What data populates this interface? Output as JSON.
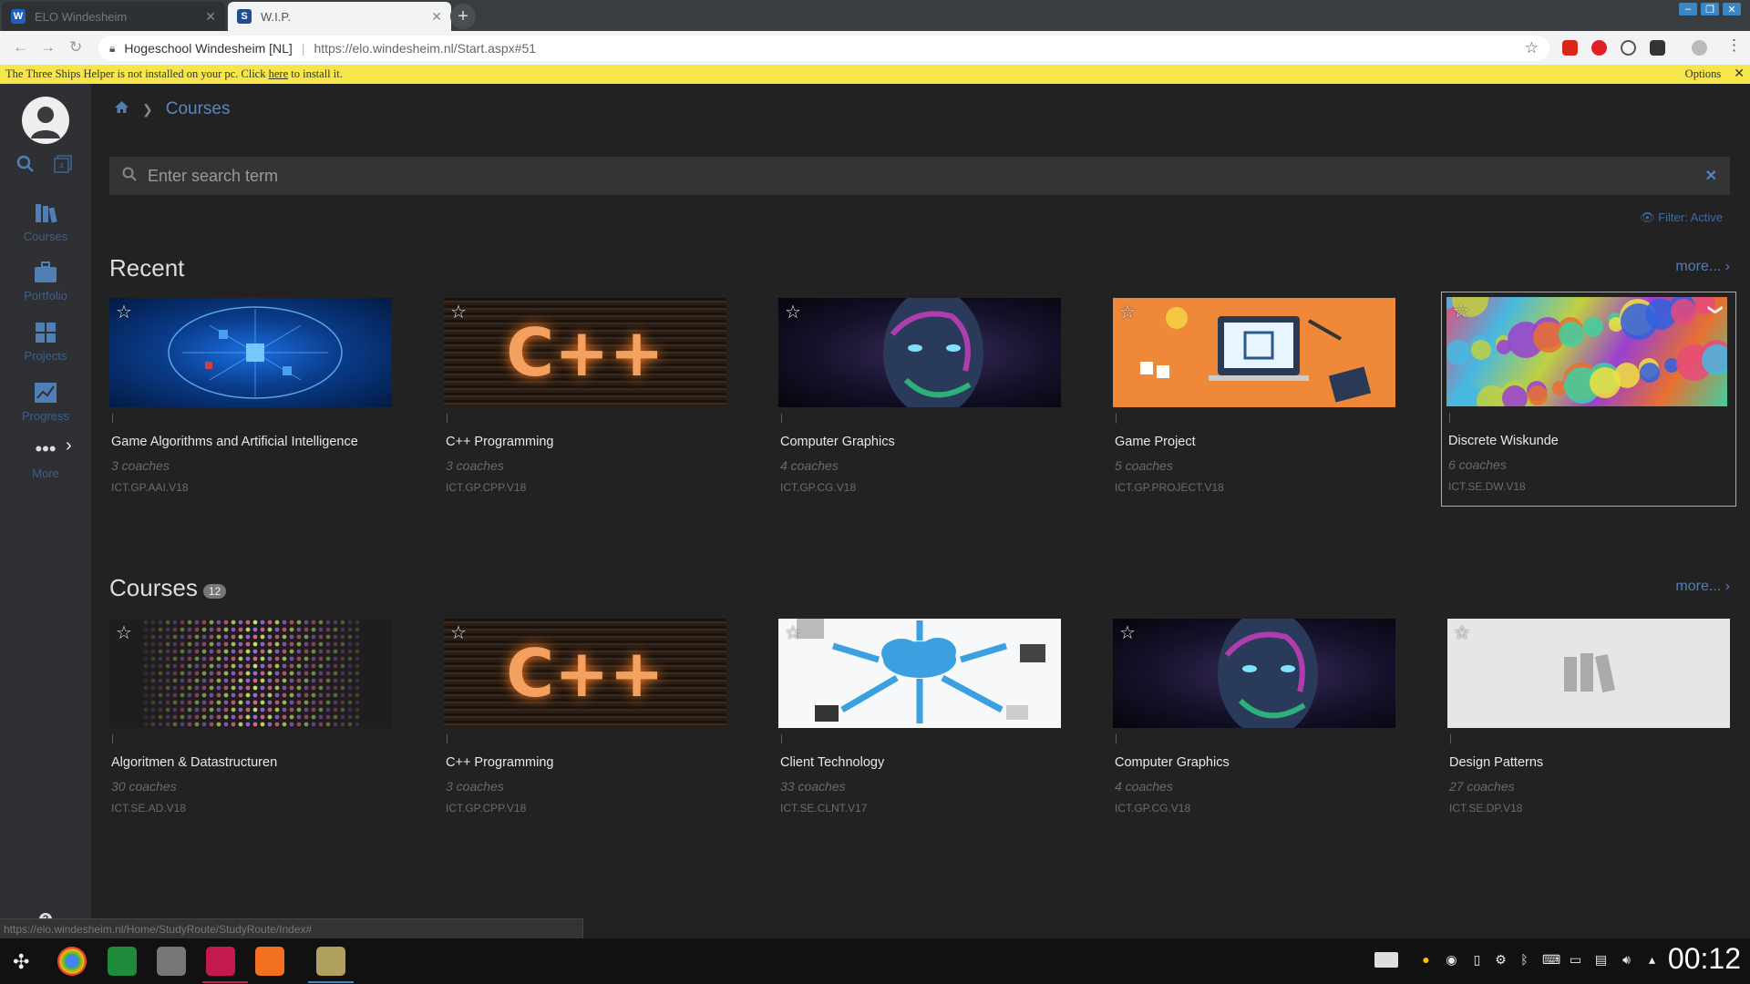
{
  "browser": {
    "tabs": [
      {
        "title": "ELO Windesheim",
        "favicon": "W",
        "active": false
      },
      {
        "title": "W.I.P.",
        "favicon": "S",
        "active": true
      }
    ],
    "address": {
      "site": "Hogeschool Windesheim [NL]",
      "url": "https://elo.windesheim.nl/Start.aspx#51"
    },
    "infobar": {
      "text": "The Three Ships Helper is not installed on your pc. Click",
      "link": "here",
      "suffix": "to install it.",
      "options": "Options"
    },
    "status_url": "https://elo.windesheim.nl/Home/StudyRoute/StudyRoute/Index#"
  },
  "sidebar": {
    "items": [
      {
        "label": "Courses",
        "icon": "books-icon"
      },
      {
        "label": "Portfolio",
        "icon": "briefcase-icon"
      },
      {
        "label": "Projects",
        "icon": "puzzle-icon"
      },
      {
        "label": "Progress",
        "icon": "chart-icon"
      },
      {
        "label": "More",
        "icon": "ellipsis-icon"
      }
    ]
  },
  "breadcrumb": {
    "current": "Courses"
  },
  "search": {
    "placeholder": "Enter search term"
  },
  "filter": {
    "label": "Filter: Active"
  },
  "recent": {
    "title": "Recent",
    "more": "more...",
    "cards": [
      {
        "name": "Game Algorithms and Artificial Intelligence",
        "coaches": "3 coaches",
        "code": "ICT.GP.AAI.V18",
        "thumb": "ai"
      },
      {
        "name": "C++ Programming",
        "coaches": "3 coaches",
        "code": "ICT.GP.CPP.V18",
        "thumb": "cpp"
      },
      {
        "name": "Computer Graphics",
        "coaches": "4 coaches",
        "code": "ICT.GP.CG.V18",
        "thumb": "cg"
      },
      {
        "name": "Game Project",
        "coaches": "5 coaches",
        "code": "ICT.GP.PROJECT.V18",
        "thumb": "gp"
      },
      {
        "name": "Discrete Wiskunde",
        "coaches": "6 coaches",
        "code": "ICT.SE.DW.V18",
        "thumb": "dw"
      }
    ]
  },
  "courses": {
    "title": "Courses",
    "count": "12",
    "more": "more...",
    "cards": [
      {
        "name": "Algoritmen & Datastructuren",
        "coaches": "30 coaches",
        "code": "ICT.SE.AD.V18",
        "thumb": "algo"
      },
      {
        "name": "C++ Programming",
        "coaches": "3 coaches",
        "code": "ICT.GP.CPP.V18",
        "thumb": "cpp"
      },
      {
        "name": "Client Technology",
        "coaches": "33 coaches",
        "code": "ICT.SE.CLNT.V17",
        "thumb": "ct"
      },
      {
        "name": "Computer Graphics",
        "coaches": "4 coaches",
        "code": "ICT.GP.CG.V18",
        "thumb": "cg"
      },
      {
        "name": "Design Patterns",
        "coaches": "27 coaches",
        "code": "ICT.SE.DP.V18",
        "thumb": "dp"
      }
    ]
  },
  "thumb_text": {
    "cpp": "C++"
  },
  "taskbar": {
    "clock": "00:12"
  },
  "colors": {
    "accent": "#4f7fb5",
    "infobar": "#f7e64a",
    "sidebar": "#2f3033",
    "main": "#222222"
  }
}
